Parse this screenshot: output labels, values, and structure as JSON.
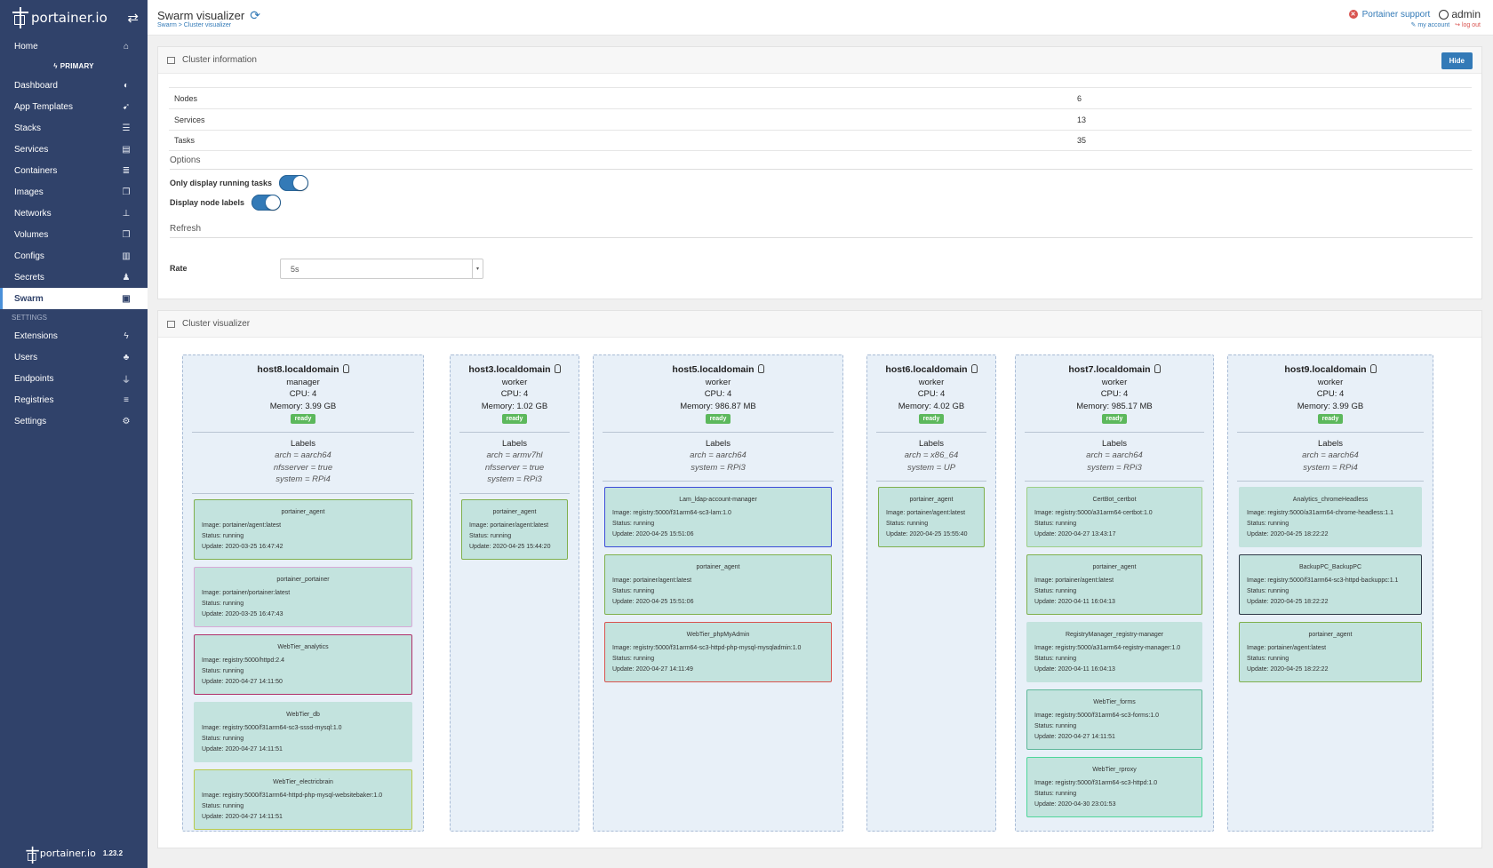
{
  "sidebar": {
    "logo_text": "portainer.io",
    "endpoint_label": "PRIMARY",
    "items": [
      {
        "label": "Home",
        "icon": "home-icon",
        "glyph": "⌂"
      },
      {
        "label": "Dashboard",
        "icon": "tachometer-icon",
        "glyph": "◐"
      },
      {
        "label": "App Templates",
        "icon": "rocket-icon",
        "glyph": "➹"
      },
      {
        "label": "Stacks",
        "icon": "th-list-icon",
        "glyph": "☰"
      },
      {
        "label": "Services",
        "icon": "list-alt-icon",
        "glyph": "▤"
      },
      {
        "label": "Containers",
        "icon": "server-icon",
        "glyph": "≣"
      },
      {
        "label": "Images",
        "icon": "clone-icon",
        "glyph": "❐"
      },
      {
        "label": "Networks",
        "icon": "sitemap-icon",
        "glyph": "⊥"
      },
      {
        "label": "Volumes",
        "icon": "cubes-icon",
        "glyph": "❒"
      },
      {
        "label": "Configs",
        "icon": "file-code-icon",
        "glyph": "▥"
      },
      {
        "label": "Secrets",
        "icon": "user-secret-icon",
        "glyph": "♟"
      },
      {
        "label": "Swarm",
        "icon": "object-group-icon",
        "glyph": "▣"
      },
      {
        "label": "Extensions",
        "icon": "bolt-icon",
        "glyph": "ϟ"
      },
      {
        "label": "Users",
        "icon": "users-icon",
        "glyph": "♣"
      },
      {
        "label": "Endpoints",
        "icon": "plug-icon",
        "glyph": "⏚"
      },
      {
        "label": "Registries",
        "icon": "database-icon",
        "glyph": "≡"
      },
      {
        "label": "Settings",
        "icon": "cogs-icon",
        "glyph": "⚙"
      }
    ],
    "settings_section": "SETTINGS",
    "footer_logo": "portainer.io",
    "version": "1.23.2"
  },
  "header": {
    "title": "Swarm visualizer",
    "breadcrumb": "Swarm > Cluster visualizer",
    "support": "Portainer support",
    "user": "admin",
    "my_account": "my account",
    "log_out": "log out"
  },
  "cluster_info": {
    "title": "Cluster information",
    "hide_label": "Hide",
    "rows": [
      {
        "label": "Nodes",
        "value": "6"
      },
      {
        "label": "Services",
        "value": "13"
      },
      {
        "label": "Tasks",
        "value": "35"
      }
    ],
    "options_title": "Options",
    "opt_running": "Only display running tasks",
    "opt_labels": "Display node labels",
    "running_on": true,
    "labels_on": true,
    "refresh_title": "Refresh",
    "rate_label": "Rate",
    "rate_value": "5s"
  },
  "visualizer": {
    "title": "Cluster visualizer",
    "labels_title": "Labels",
    "nodes": [
      {
        "hostname": "host8.localdomain",
        "role": "manager",
        "cpu": "CPU: 4",
        "memory": "Memory: 3.99 GB",
        "status": "ready",
        "labels": [
          "arch = aarch64",
          "nfsserver = true",
          "system = RPi4"
        ],
        "tasks": [
          {
            "name": "portainer_agent",
            "image": "Image: portainer/agent:latest",
            "status": "Status: running",
            "update": "Update: 2020-03-25 16:47:42",
            "color": "#7fb04d"
          },
          {
            "name": "portainer_portainer",
            "image": "Image: portainer/portainer:latest",
            "status": "Status: running",
            "update": "Update: 2020-03-25 16:47:43",
            "color": "#d8a9d8"
          },
          {
            "name": "WebTier_analytics",
            "image": "Image: registry:5000/httpd:2.4",
            "status": "Status: running",
            "update": "Update: 2020-04-27 14:11:50",
            "color": "#b0306a"
          },
          {
            "name": "WebTier_db",
            "image": "Image: registry:5000/f31arm64-sc3-sssd-mysql:1.0",
            "status": "Status: running",
            "update": "Update: 2020-04-27 14:11:51",
            "color": "#c3e3de"
          },
          {
            "name": "WebTier_electricbrain",
            "image": "Image: registry:5000/f31arm64-httpd-php-mysql-websitebaker:1.0",
            "status": "Status: running",
            "update": "Update: 2020-04-27 14:11:51",
            "color": "#b7c94a"
          }
        ]
      },
      {
        "hostname": "host3.localdomain",
        "role": "worker",
        "cpu": "CPU: 4",
        "memory": "Memory: 1.02 GB",
        "status": "ready",
        "labels": [
          "arch = armv7hl",
          "nfsserver = true",
          "system = RPi3"
        ],
        "tasks": [
          {
            "name": "portainer_agent",
            "image": "Image: portainer/agent:latest",
            "status": "Status: running",
            "update": "Update: 2020-04-25 15:44:20",
            "color": "#7fb04d"
          }
        ]
      },
      {
        "hostname": "host5.localdomain",
        "role": "worker",
        "cpu": "CPU: 4",
        "memory": "Memory: 986.87 MB",
        "status": "ready",
        "labels": [
          "arch = aarch64",
          "system = RPi3"
        ],
        "tasks": [
          {
            "name": "Lam_ldap-account-manager",
            "image": "Image: registry:5000/f31arm64-sc3-lam:1.0",
            "status": "Status: running",
            "update": "Update: 2020-04-25 15:51:06",
            "color": "#3b4bd8"
          },
          {
            "name": "portainer_agent",
            "image": "Image: portainer/agent:latest",
            "status": "Status: running",
            "update": "Update: 2020-04-25 15:51:06",
            "color": "#7fb04d"
          },
          {
            "name": "WebTier_phpMyAdmin",
            "image": "Image: registry:5000/f31arm64-sc3-httpd-php-mysql-mysqladmin:1.0",
            "status": "Status: running",
            "update": "Update: 2020-04-27 14:11:49",
            "color": "#d9534f"
          }
        ]
      },
      {
        "hostname": "host6.localdomain",
        "role": "worker",
        "cpu": "CPU: 4",
        "memory": "Memory: 4.02 GB",
        "status": "ready",
        "labels": [
          "arch = x86_64",
          "system = UP"
        ],
        "tasks": [
          {
            "name": "portainer_agent",
            "image": "Image: portainer/agent:latest",
            "status": "Status: running",
            "update": "Update: 2020-04-25 15:55:40",
            "color": "#7fb04d"
          }
        ]
      },
      {
        "hostname": "host7.localdomain",
        "role": "worker",
        "cpu": "CPU: 4",
        "memory": "Memory: 985.17 MB",
        "status": "ready",
        "labels": [
          "arch = aarch64",
          "system = RPi3"
        ],
        "tasks": [
          {
            "name": "CertBot_certbot",
            "image": "Image: registry:5000/a31arm64-certbot:1.0",
            "status": "Status: running",
            "update": "Update: 2020-04-27 13:43:17",
            "color": "#9ccf85"
          },
          {
            "name": "portainer_agent",
            "image": "Image: portainer/agent:latest",
            "status": "Status: running",
            "update": "Update: 2020-04-11 16:04:13",
            "color": "#7fb04d"
          },
          {
            "name": "RegistryManager_registry-manager",
            "image": "Image: registry:5000/a31arm64-registry-manager:1.0",
            "status": "Status: running",
            "update": "Update: 2020-04-11 16:04:13",
            "color": "#c3e3de"
          },
          {
            "name": "WebTier_forms",
            "image": "Image: registry:5000/f31arm64-sc3-forms:1.0",
            "status": "Status: running",
            "update": "Update: 2020-04-27 14:11:51",
            "color": "#5fb89a"
          },
          {
            "name": "WebTier_rproxy",
            "image": "Image: registry:5000/f31arm64-sc3-httpd:1.0",
            "status": "Status: running",
            "update": "Update: 2020-04-30 23:01:53",
            "color": "#4fd69a"
          }
        ]
      },
      {
        "hostname": "host9.localdomain",
        "role": "worker",
        "cpu": "CPU: 4",
        "memory": "Memory: 3.99 GB",
        "status": "ready",
        "labels": [
          "arch = aarch64",
          "system = RPi4"
        ],
        "tasks": [
          {
            "name": "Analytics_chromeHeadless",
            "image": "Image: registry:5000/a31arm64-chrome-headless:1.1",
            "status": "Status: running",
            "update": "Update: 2020-04-25 18:22:22",
            "color": "#c3e3de"
          },
          {
            "name": "BackupPC_BackupPC",
            "image": "Image: registry:5000/f31arm64-sc3-httpd-backuppc:1.1",
            "status": "Status: running",
            "update": "Update: 2020-04-25 18:22:22",
            "color": "#2f3a48"
          },
          {
            "name": "portainer_agent",
            "image": "Image: portainer/agent:latest",
            "status": "Status: running",
            "update": "Update: 2020-04-25 18:22:22",
            "color": "#7fb04d"
          }
        ]
      }
    ]
  }
}
